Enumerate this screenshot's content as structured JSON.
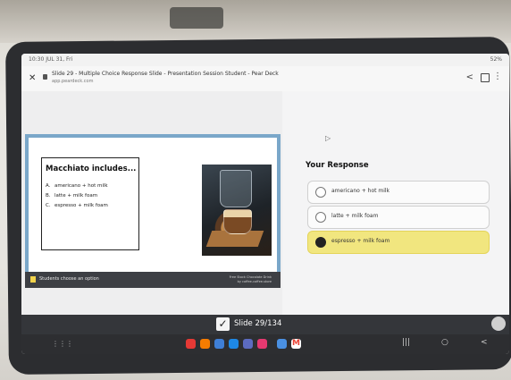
{
  "status_bar": {
    "time": "10:30  JUL 31, Fri",
    "system": "52%"
  },
  "browser": {
    "tab_title": "Slide 29 - Multiple Choice Response Slide - Presentation Session Student - Pear Deck",
    "url": "app.peardeck.com",
    "close_glyph": "✕",
    "share_glyph": "<",
    "more_glyph": "⋮"
  },
  "slide": {
    "question_title": "Macchiato includes...",
    "options": [
      {
        "letter": "A.",
        "text": "americano + hot milk"
      },
      {
        "letter": "B.",
        "text": "latte + milk foam"
      },
      {
        "letter": "C.",
        "text": "espresso + milk foam"
      }
    ],
    "footer_text": "Students choose an option",
    "credit_line1": "Free Stock Chocolate Drink",
    "credit_line2": "by coffee-coffee-store"
  },
  "response": {
    "title": "Your Response",
    "options": [
      {
        "text": "americano + hot milk",
        "selected": false
      },
      {
        "text": "latte + milk foam",
        "selected": false
      },
      {
        "text": "espresso + milk foam",
        "selected": true
      }
    ]
  },
  "slide_bar": {
    "check_glyph": "✓",
    "label": "Slide 29/134"
  },
  "nav": {
    "grid_glyph": "⋮⋮⋮",
    "recents_glyph": "|||",
    "home_glyph": "○",
    "back_glyph": "<"
  },
  "dock_apps": [
    {
      "name": "app-red-icon",
      "color": "#e53935"
    },
    {
      "name": "app-orange-icon",
      "color": "#f57c00"
    },
    {
      "name": "app-blue-icon",
      "color": "#3f7fd6"
    },
    {
      "name": "app-chat-icon",
      "color": "#1e88e5"
    },
    {
      "name": "app-purple-icon",
      "color": "#5c6bc0"
    },
    {
      "name": "app-pink-icon",
      "color": "#e53970"
    },
    {
      "name": "app-multi-icon",
      "color": "#4a90e2"
    },
    {
      "name": "gmail-icon",
      "color": "#ea4335"
    }
  ],
  "colors": {
    "selected_option": "#f1e67f",
    "slide_frame": "#7aa7c9"
  }
}
